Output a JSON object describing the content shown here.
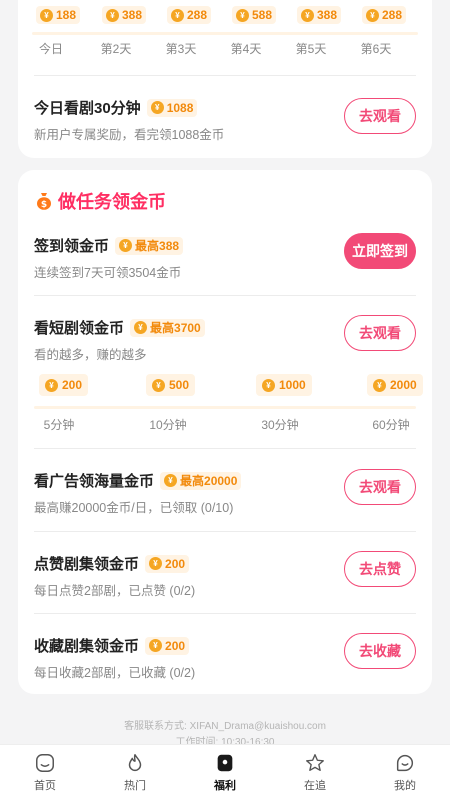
{
  "checkin_days": [
    {
      "reward": "188",
      "label": "今日"
    },
    {
      "reward": "388",
      "label": "第2天"
    },
    {
      "reward": "288",
      "label": "第3天"
    },
    {
      "reward": "588",
      "label": "第4天"
    },
    {
      "reward": "388",
      "label": "第5天"
    },
    {
      "reward": "288",
      "label": "第6天"
    }
  ],
  "watch30": {
    "title": "今日看剧30分钟",
    "reward": "1088",
    "sub": "新用户专属奖励，看完领1088金币",
    "button": "去观看"
  },
  "section": {
    "title": "做任务领金币"
  },
  "tasks": {
    "signin": {
      "title": "签到领金币",
      "reward": "最高388",
      "sub": "连续签到7天可领3504金币",
      "button": "立即签到"
    },
    "short": {
      "title": "看短剧领金币",
      "reward": "最高3700",
      "sub": "看的越多，赚的越多",
      "button": "去观看"
    },
    "ad": {
      "title": "看广告领海量金币",
      "reward": "最高20000",
      "sub": "最高赚20000金币/日，已领取 (0/10)",
      "button": "去观看"
    },
    "like": {
      "title": "点赞剧集领金币",
      "reward": "200",
      "sub": "每日点赞2部剧，已点赞 (0/2)",
      "button": "去点赞"
    },
    "fav": {
      "title": "收藏剧集领金币",
      "reward": "200",
      "sub": "每日收藏2部剧，已收藏 (0/2)",
      "button": "去收藏"
    }
  },
  "minutes": [
    {
      "reward": "200",
      "label": "5分钟"
    },
    {
      "reward": "500",
      "label": "10分钟"
    },
    {
      "reward": "1000",
      "label": "30分钟"
    },
    {
      "reward": "2000",
      "label": "60分钟"
    }
  ],
  "footer": {
    "contact": "客服联系方式: XIFAN_Drama@kuaishou.com",
    "hours": "工作时间: 10:30-16:30"
  },
  "coin_symbol": "¥",
  "tabs": [
    {
      "label": "首页",
      "icon": "home-icon"
    },
    {
      "label": "热门",
      "icon": "flame-icon"
    },
    {
      "label": "福利",
      "icon": "gift-icon"
    },
    {
      "label": "在追",
      "icon": "star-icon"
    },
    {
      "label": "我的",
      "icon": "profile-icon"
    }
  ],
  "colors": {
    "accent": "#f24a77",
    "coin": "#f5a623",
    "coin_text": "#f28a0c",
    "section": "#ff2f63"
  }
}
